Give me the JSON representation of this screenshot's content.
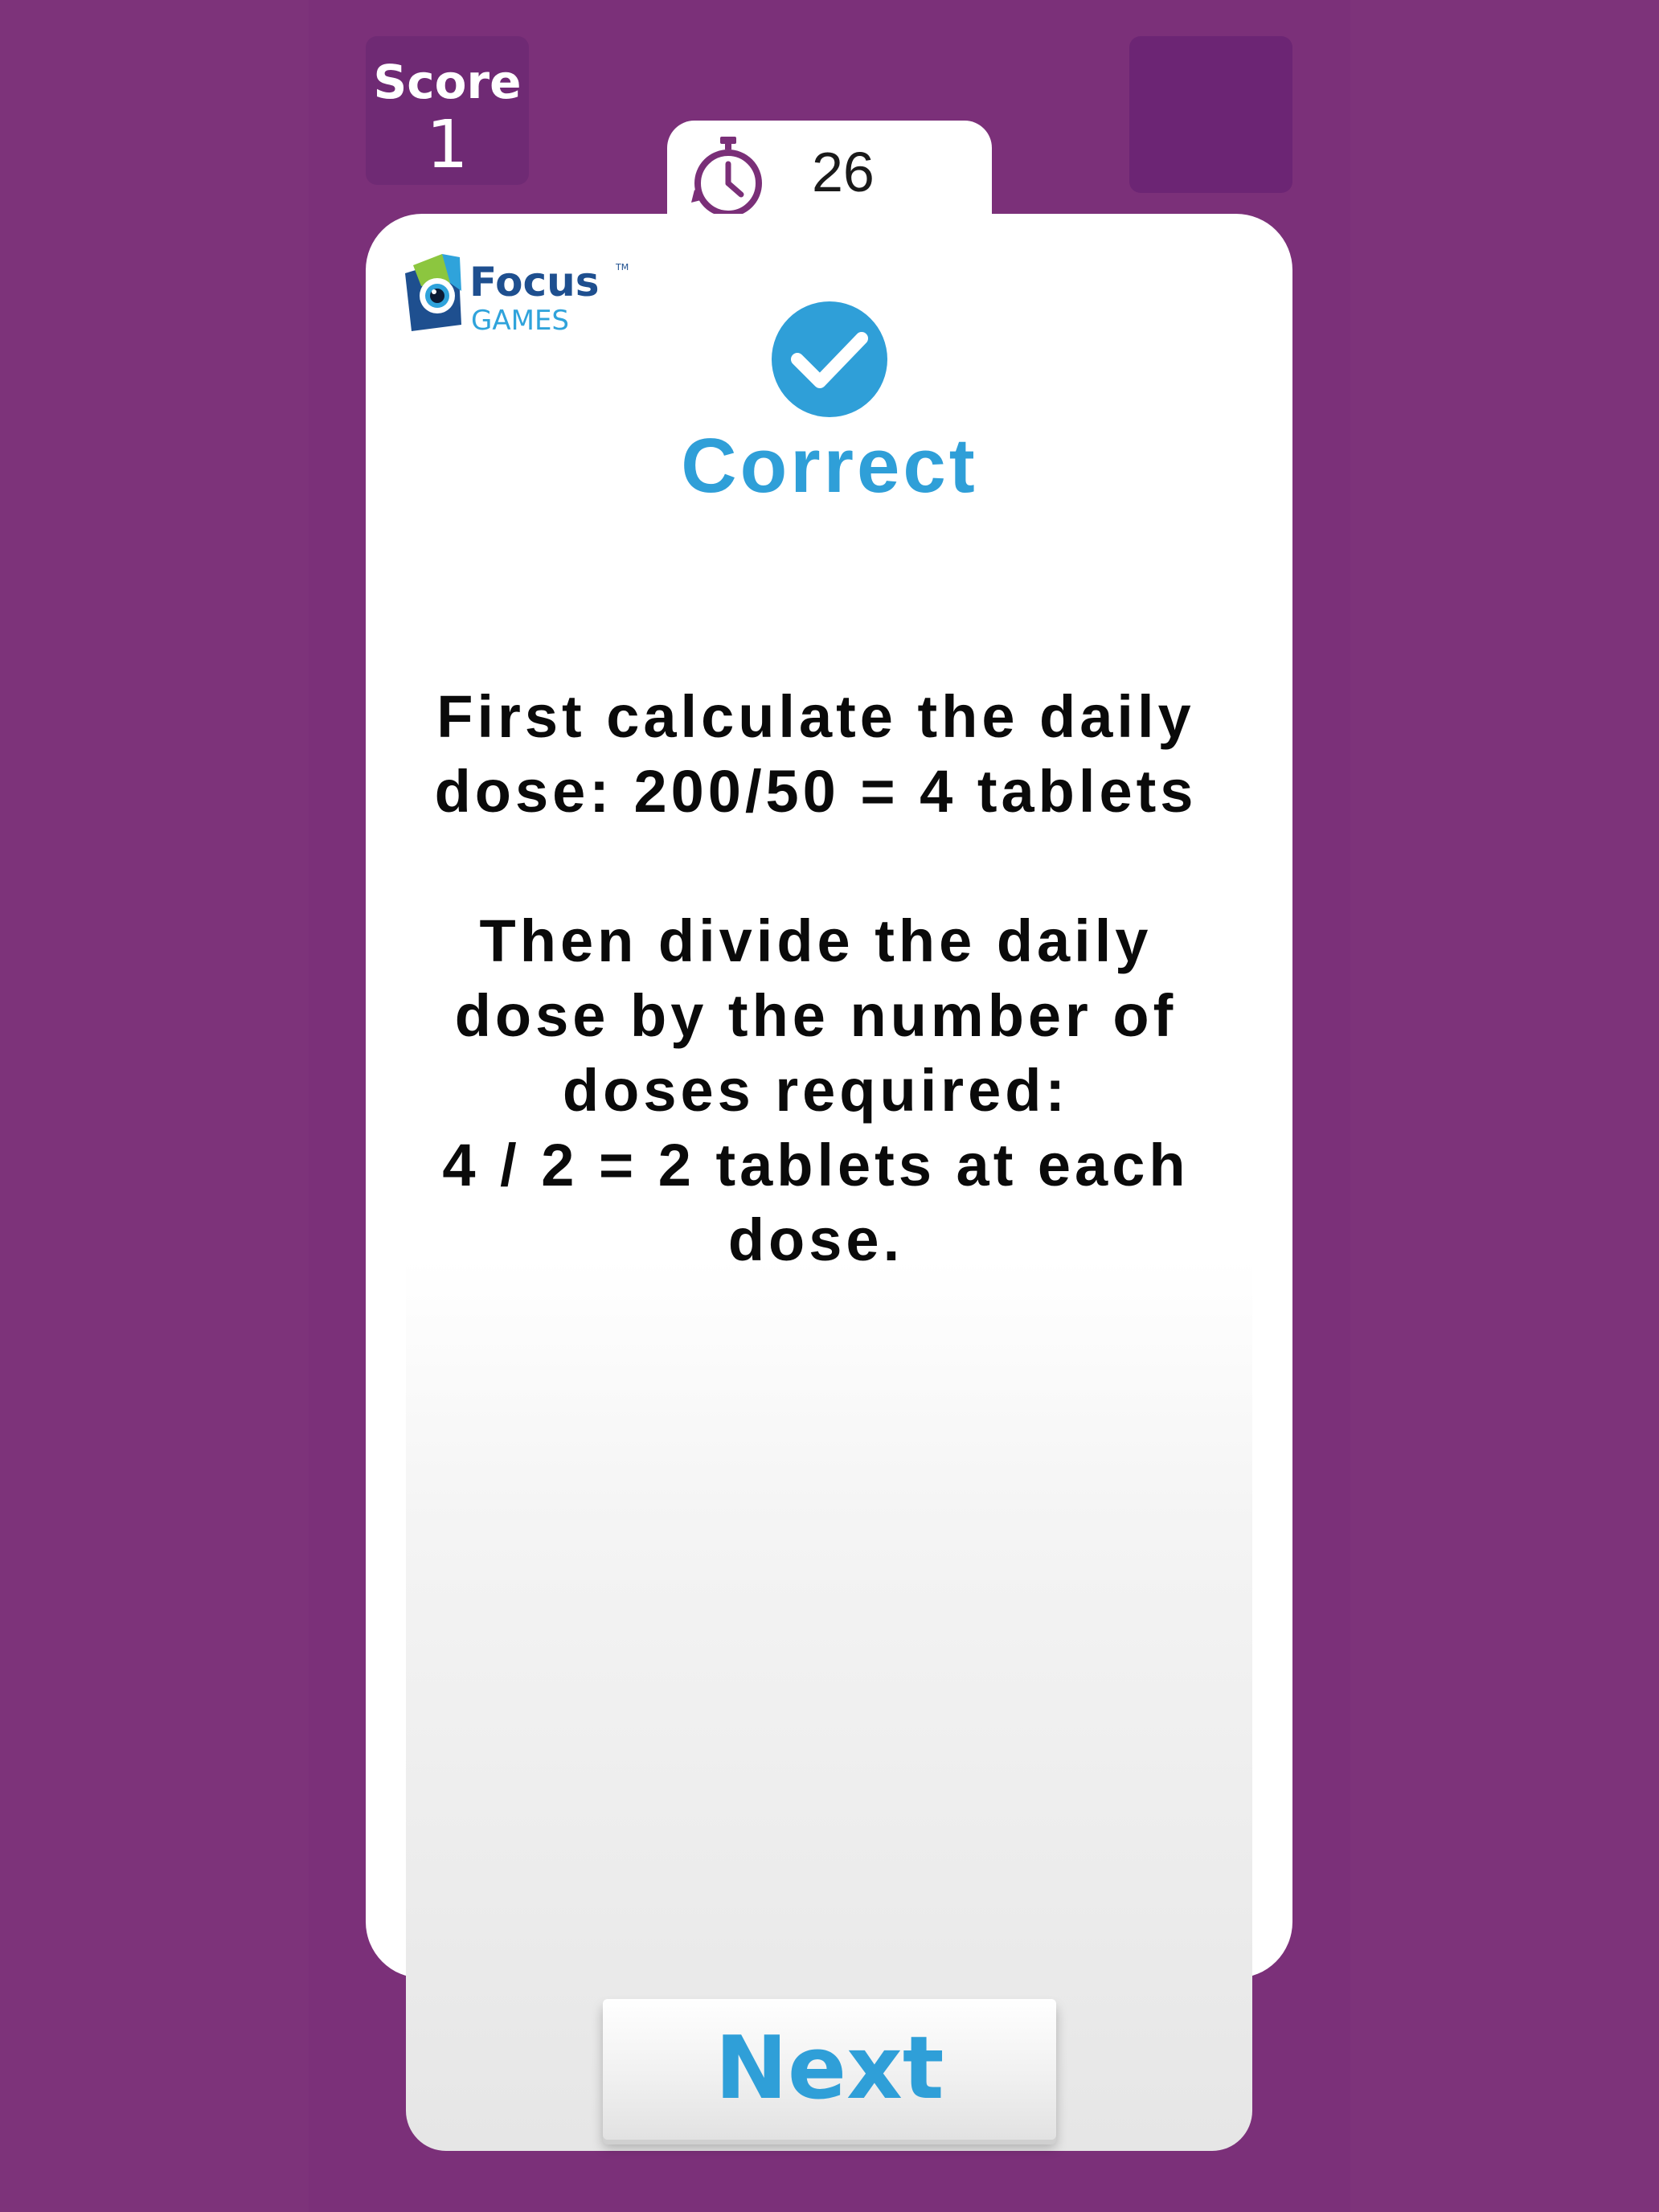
{
  "score": {
    "label": "Score",
    "value": "1"
  },
  "timer": {
    "icon": "stopwatch-icon",
    "value": "26"
  },
  "logo": {
    "text_main": "Focus",
    "text_sub": "GAMES",
    "trademark": "TM"
  },
  "result": {
    "icon": "check-circle-icon",
    "title": "Correct"
  },
  "explanation": {
    "line1": "First calculate the daily",
    "line2": "dose: 200/50 = 4 tablets",
    "line3": "Then divide the daily",
    "line4": "dose by the number of",
    "line5": "doses required:",
    "line6": "4 / 2 = 2 tablets at each",
    "line7": "dose."
  },
  "next_button": {
    "label": "Next"
  },
  "colors": {
    "background": "#7d337a",
    "accent": "#2f9fd8",
    "timer_icon": "#7a2f78"
  }
}
